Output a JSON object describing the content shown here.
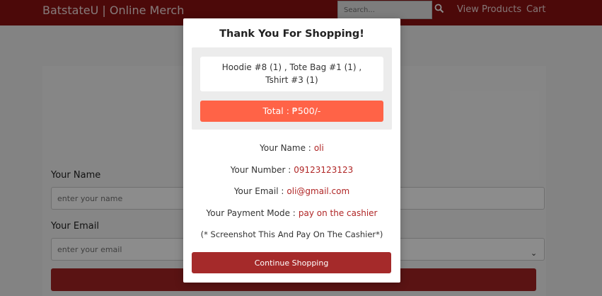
{
  "header": {
    "logo": "BatstateU | Online Merch",
    "search_placeholder": "Search...",
    "nav": {
      "view_products": "View Products",
      "cart": "Cart"
    }
  },
  "form": {
    "name_label": "Your Name",
    "name_placeholder": "enter your name",
    "email_label": "Your Email",
    "email_placeholder": "enter your email"
  },
  "modal": {
    "title": "Thank You For Shopping!",
    "items": "Hoodie #8 (1) , Tote Bag #1 (1) , Tshirt #3 (1)",
    "total": "Total : ₱500/-",
    "name_label": "Your Name :",
    "name_value": "oli",
    "number_label": "Your Number :",
    "number_value": "09123123123",
    "email_label": "Your Email :",
    "email_value": "oli@gmail.com",
    "payment_label": "Your Payment Mode :",
    "payment_value": "pay on the cashier",
    "note": "(* Screenshot This And Pay On The Cashier*)",
    "continue_label": "Continue Shopping"
  },
  "colors": {
    "header": "#8b1111",
    "total_button": "#ff6347",
    "continue_button": "#a52a2a",
    "value_text": "#b02626"
  },
  "icons": {
    "search": "search-icon",
    "select_arrow": "chevron-down-icon"
  }
}
